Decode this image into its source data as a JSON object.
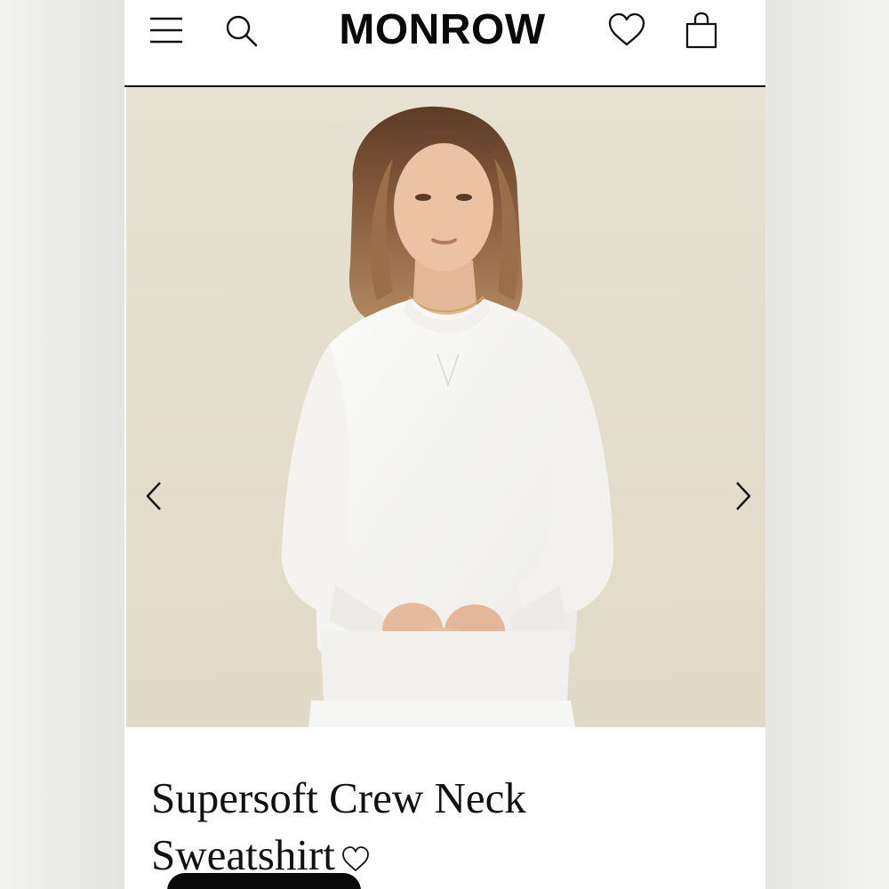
{
  "header": {
    "brand": "MONROW",
    "icons": {
      "menu": "hamburger-menu-icon",
      "search": "search-icon",
      "wishlist": "heart-outline-icon",
      "cart": "shopping-bag-icon"
    }
  },
  "gallery": {
    "background_color": "#e3ddcc",
    "image_alt": "Model wearing white crew neck sweatshirt",
    "icons": {
      "previous": "chevron-left-icon",
      "next": "chevron-right-icon"
    }
  },
  "product": {
    "title_line1": "Supersoft Crew Neck",
    "title_line2": "Sweatshirt",
    "favorite_icon": "heart-outline-icon"
  },
  "colors": {
    "text": "#111111",
    "background": "#ffffff",
    "photo_backdrop": "#e3ddcc",
    "garment": "#f7f7f5"
  }
}
